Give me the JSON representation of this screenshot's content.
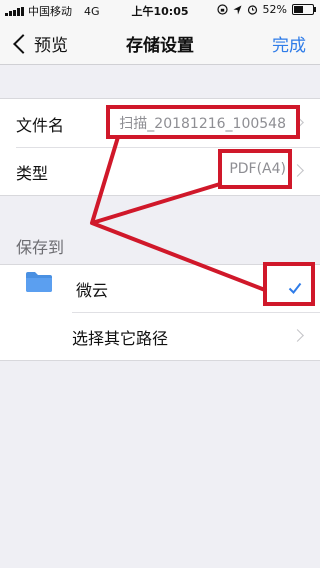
{
  "status_bar": {
    "carrier": "中国移动",
    "network": "4G",
    "time": "上午10:05",
    "battery_percent": "52%",
    "battery_level": 0.52
  },
  "nav": {
    "back_label": "预览",
    "title": "存储设置",
    "done_label": "完成"
  },
  "file_group": {
    "filename_label": "文件名",
    "filename_value": "扫描_20181216_100548",
    "type_label": "类型",
    "type_value": "PDF(A4)"
  },
  "save_to": {
    "header": "保存到",
    "weiyun_label": "微云",
    "other_path_label": "选择其它路径"
  },
  "colors": {
    "accent": "#2f7ce8",
    "annotation": "#d0182a",
    "folder": "#4a90e2"
  },
  "icons": [
    "signal-icon",
    "lock-rotation-icon",
    "location-icon",
    "alarm-icon",
    "battery-icon",
    "back-chevron-icon",
    "folder-icon",
    "checkmark-icon",
    "chevron-right-icon"
  ]
}
